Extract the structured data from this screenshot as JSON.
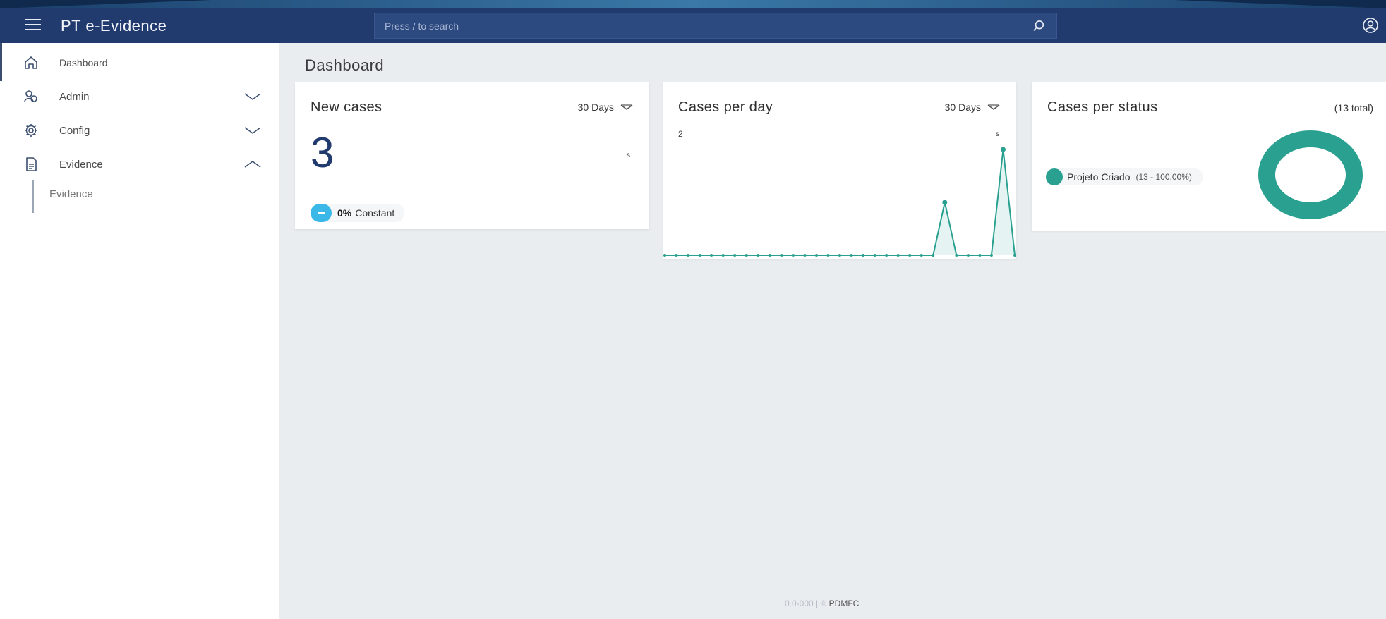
{
  "header": {
    "title": "PT e-Evidence",
    "search_placeholder": "Press / to search"
  },
  "sidebar": {
    "items": [
      {
        "label": "Dashboard",
        "icon": "home-icon"
      },
      {
        "label": "Admin",
        "icon": "users-icon",
        "expanded": false
      },
      {
        "label": "Config",
        "icon": "gear-icon",
        "expanded": false
      },
      {
        "label": "Evidence",
        "icon": "document-icon",
        "expanded": true
      }
    ],
    "sub_items": [
      {
        "label": "Evidence"
      }
    ]
  },
  "page": {
    "title": "Dashboard"
  },
  "cards": {
    "new_cases": {
      "title": "New cases",
      "period": "30 Days",
      "value": "3",
      "marker": "s",
      "trend_percent": "0%",
      "trend_label": "Constant"
    },
    "cases_per_day": {
      "title": "Cases per day",
      "period": "30 Days",
      "y_max_label": "2",
      "marker": "s"
    },
    "cases_per_status": {
      "title": "Cases per status",
      "total": "(13 total)",
      "legend_name": "Projeto Criado",
      "legend_value": "(13 - 100.00%)"
    }
  },
  "chart_data": [
    {
      "type": "line",
      "title": "Cases per day",
      "x": [
        1,
        2,
        3,
        4,
        5,
        6,
        7,
        8,
        9,
        10,
        11,
        12,
        13,
        14,
        15,
        16,
        17,
        18,
        19,
        20,
        21,
        22,
        23,
        24,
        25,
        26,
        27,
        28,
        29,
        30,
        31
      ],
      "values": [
        0,
        0,
        0,
        0,
        0,
        0,
        0,
        0,
        0,
        0,
        0,
        0,
        0,
        0,
        0,
        0,
        0,
        0,
        0,
        0,
        0,
        0,
        0,
        0,
        1,
        0,
        0,
        0,
        0,
        2,
        0
      ],
      "ylim": [
        0,
        2
      ],
      "color": "#2aa190"
    },
    {
      "type": "pie",
      "title": "Cases per status",
      "categories": [
        "Projeto Criado"
      ],
      "values": [
        13
      ],
      "color": "#2aa190"
    }
  ],
  "colors": {
    "header": "#223b6e",
    "accent": "#2aa190",
    "trend_badge": "#3ab8e8"
  },
  "footer": {
    "version": "0.0-000 | ©",
    "brand": "PDMFC"
  }
}
